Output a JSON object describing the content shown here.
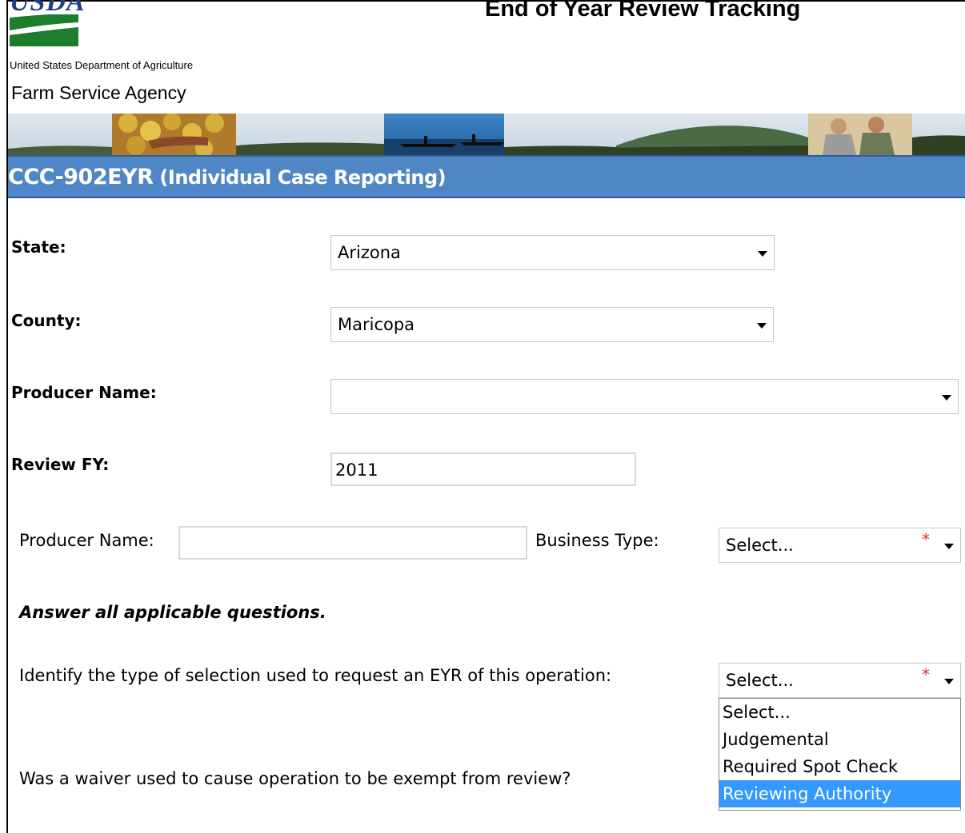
{
  "header": {
    "logo_text": "USDA",
    "department": "United States Department of Agriculture",
    "agency": "Farm Service Agency",
    "app_title": "End of Year Review Tracking"
  },
  "form_bar": {
    "form_code": "CCC-902EYR",
    "form_desc": "(Individual Case Reporting)",
    "color": "#4f87c6"
  },
  "fields": {
    "state": {
      "label": "State:",
      "value": "Arizona"
    },
    "county": {
      "label": "County:",
      "value": "Maricopa"
    },
    "producer_name_select": {
      "label": "Producer Name:",
      "value": ""
    },
    "review_fy": {
      "label": "Review FY:",
      "value": "2011"
    },
    "producer_name_input": {
      "label": "Producer Name:",
      "value": ""
    },
    "business_type": {
      "label": "Business Type:",
      "value": "Select...",
      "required_mark": "*"
    }
  },
  "questions": {
    "instruction": "Answer all applicable questions.",
    "selection_type": {
      "label": "Identify the type of selection used to request an EYR of this operation:",
      "value": "Select...",
      "required_mark": "*",
      "options": [
        "Select...",
        "Judgemental",
        "Required Spot Check",
        "Reviewing Authority"
      ],
      "highlighted": "Reviewing Authority"
    },
    "waiver": {
      "label": "Was a waiver used to cause operation to be exempt from review?"
    }
  },
  "icons": [
    "usda-logo-icon",
    "chevron-down-icon",
    "required-asterisk-icon"
  ],
  "colors": {
    "required": "#e03030",
    "highlight": "#3399ff",
    "logo": "#1f3c86"
  }
}
